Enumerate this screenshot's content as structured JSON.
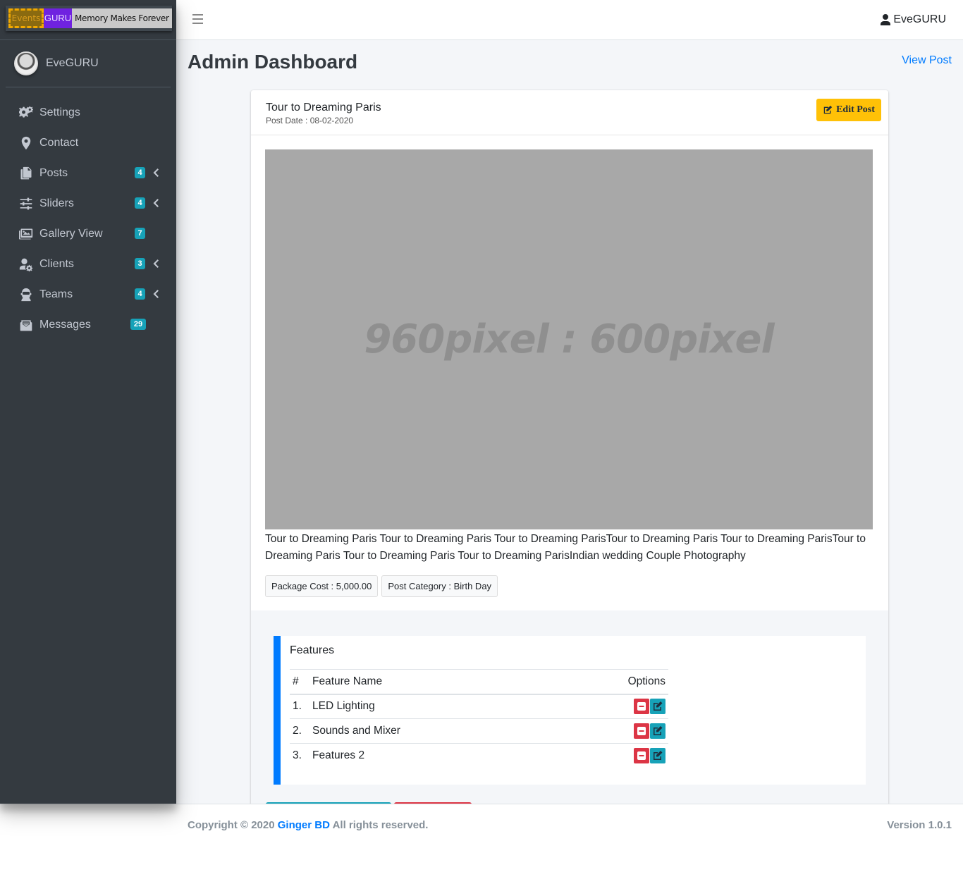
{
  "brand": {
    "logo_part1": "Events",
    "logo_part2": "GURU",
    "tagline": "Memory Makes Forever"
  },
  "sidebar": {
    "user": "EveGURU",
    "items": [
      {
        "label": "Settings",
        "icon": "gears-icon"
      },
      {
        "label": "Contact",
        "icon": "map-marker-icon"
      },
      {
        "label": "Posts",
        "icon": "copy-icon",
        "badge": "4",
        "chevron": true
      },
      {
        "label": "Sliders",
        "icon": "sliders-icon",
        "badge": "4",
        "chevron": true
      },
      {
        "label": "Gallery View",
        "icon": "images-icon",
        "badge": "7"
      },
      {
        "label": "Clients",
        "icon": "user-cog-icon",
        "badge": "3",
        "chevron": true
      },
      {
        "label": "Teams",
        "icon": "user-astronaut-icon",
        "badge": "4",
        "chevron": true
      },
      {
        "label": "Messages",
        "icon": "mail-bulk-icon",
        "badge": "29"
      }
    ]
  },
  "navbar": {
    "user": "EveGURU"
  },
  "page": {
    "title": "Admin Dashboard",
    "view_post": "View Post"
  },
  "post": {
    "title": "Tour to Dreaming Paris",
    "date": "Post Date : 08-02-2020",
    "edit_label": "Edit Post",
    "image_placeholder": "960pixel : 600pixel",
    "description": "Tour to Dreaming Paris Tour to Dreaming Paris Tour to Dreaming ParisTour to Dreaming Paris Tour to Dreaming ParisTour to Dreaming Paris Tour to Dreaming Paris Tour to Dreaming ParisIndian wedding Couple Photography",
    "package_cost": "Package Cost : 5,000.00",
    "category": "Post Category : Birth Day"
  },
  "features": {
    "title": "Features",
    "headers": [
      "#",
      "Feature Name",
      "Options"
    ],
    "rows": [
      {
        "num": "1.",
        "name": "LED Lighting"
      },
      {
        "num": "2.",
        "name": "Sounds and Mixer"
      },
      {
        "num": "3.",
        "name": "Features 2"
      }
    ]
  },
  "footer": {
    "copyright_prefix": "Copyright © 2020",
    "company": "Ginger BD",
    "copyright_suffix": "All rights reserved.",
    "version": "Version 1.0.1"
  },
  "colors": {
    "sidebar_bg": "#343a40",
    "accent": "#007bff",
    "badge": "#17a2b8",
    "warning": "#ffc107",
    "danger": "#dc3545"
  }
}
